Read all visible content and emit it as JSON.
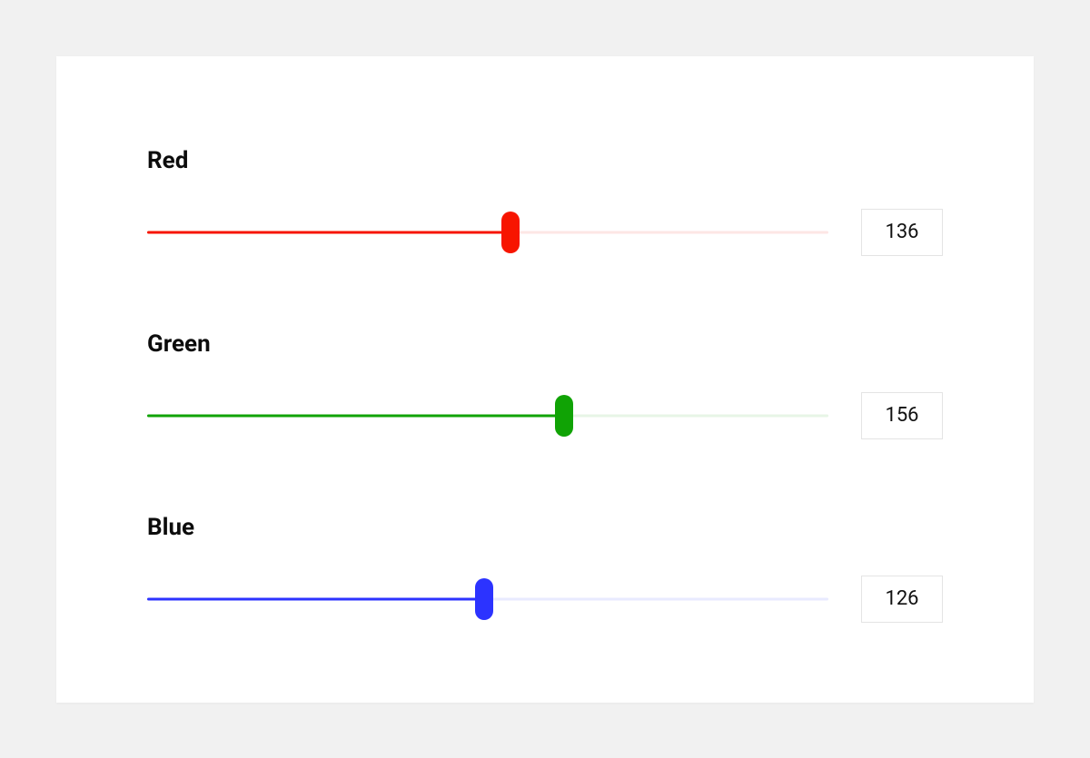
{
  "sliders": {
    "max": 255,
    "red": {
      "label": "Red",
      "value": 136,
      "color": "#f71500",
      "track_bg": "#fde6e5"
    },
    "green": {
      "label": "Green",
      "value": 156,
      "color": "#10a305",
      "track_bg": "#e7f5e6"
    },
    "blue": {
      "label": "Blue",
      "value": 126,
      "color": "#2c33ff",
      "track_bg": "#e8eaff"
    }
  }
}
